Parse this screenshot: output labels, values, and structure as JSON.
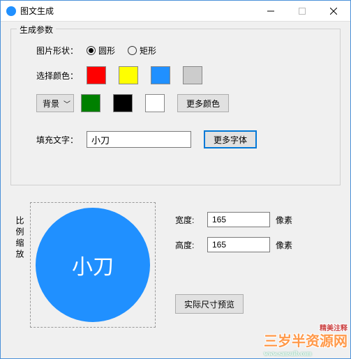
{
  "window": {
    "title": "图文生成"
  },
  "group": {
    "title": "生成参数",
    "shape": {
      "label": "图片形状：",
      "option_circle": "圆形",
      "option_rect": "矩形",
      "selected": "circle"
    },
    "color": {
      "label": "选择颜色：",
      "swatches": [
        "#ff0000",
        "#ffff00",
        "#2090ff",
        "#cccccc"
      ]
    },
    "bg": {
      "select_label": "背景",
      "swatches": [
        "#008000",
        "#000000",
        "#ffffff"
      ],
      "more_label": "更多颜色"
    },
    "text": {
      "label": "填充文字：",
      "value": "小刀",
      "more_font_label": "更多字体"
    }
  },
  "preview": {
    "scale_label": "比例缩放",
    "circle_text": "小刀",
    "circle_color": "#2090ff"
  },
  "dims": {
    "width_label": "宽度:",
    "width_value": "165",
    "height_label": "高度:",
    "height_value": "165",
    "unit": "像素",
    "actual_label": "实际尺寸预览"
  },
  "watermark": {
    "sub": "精美注释",
    "main": "三岁半资源网",
    "url": "www.sansuib.com"
  }
}
